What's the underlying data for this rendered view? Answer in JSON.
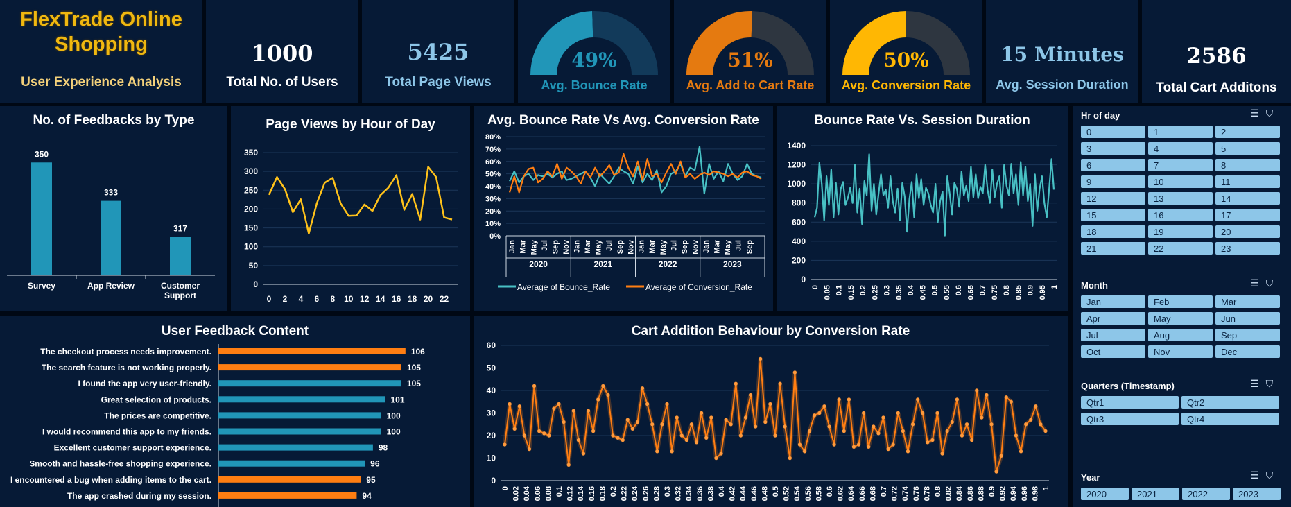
{
  "header": {
    "title": "FlexTrade Online Shopping",
    "subtitle": "User Experience Analysis"
  },
  "kpis": {
    "users": {
      "value": "1000",
      "label": "Total No. of Users"
    },
    "page_views": {
      "value": "5425",
      "label": "Total Page Views"
    },
    "session": {
      "value": "15 Minutes",
      "label": "Avg. Session Duration"
    },
    "cart": {
      "value": "2586",
      "label": "Total Cart Additons"
    }
  },
  "gauges": [
    {
      "value": "49%",
      "label": "Avg. Bounce Rate",
      "fraction": 0.49,
      "color": "#2196b8",
      "track": "#123a5a"
    },
    {
      "value": "51%",
      "label": "Avg. Add to Cart Rate",
      "fraction": 0.51,
      "color": "#e57a10",
      "track": "#2e3640"
    },
    {
      "value": "50%",
      "label": "Avg. Conversion Rate",
      "fraction": 0.5,
      "color": "#ffb703",
      "track": "#2e3640"
    }
  ],
  "colors": {
    "panel": "#061a36",
    "title_gold": "#f0b810",
    "subtitle_gold": "#f3d07a",
    "teal": "#2196b8",
    "orange": "#ff7e12",
    "yellow": "#ffc21a",
    "cyan_line": "#48c0c4",
    "slicer_btn": "#8dc6e8"
  },
  "slicers": {
    "hour": {
      "title": "Hr of day",
      "items": [
        "0",
        "1",
        "2",
        "3",
        "4",
        "5",
        "6",
        "7",
        "8",
        "9",
        "10",
        "11",
        "12",
        "13",
        "14",
        "15",
        "16",
        "17",
        "18",
        "19",
        "20",
        "21",
        "22",
        "23"
      ]
    },
    "month": {
      "title": "Month",
      "items": [
        "Jan",
        "Feb",
        "Mar",
        "Apr",
        "May",
        "Jun",
        "Jul",
        "Aug",
        "Sep",
        "Oct",
        "Nov",
        "Dec"
      ]
    },
    "quarter": {
      "title": "Quarters (Timestamp)",
      "items": [
        "Qtr1",
        "Qtr2",
        "Qtr3",
        "Qtr4"
      ]
    },
    "year": {
      "title": "Year",
      "items": [
        "2020",
        "2021",
        "2022",
        "2023"
      ]
    },
    "icons": [
      "multi-select-icon",
      "clear-filter-icon"
    ]
  },
  "chart_data": [
    {
      "id": "feedbacks",
      "type": "bar",
      "title": "No. of Feedbacks by Type",
      "categories": [
        "Survey",
        "App Review",
        "Customer Support"
      ],
      "values": [
        350,
        333,
        317
      ],
      "ylim": [
        300,
        355
      ],
      "grid": false,
      "color": "#2196b8"
    },
    {
      "id": "pageviews",
      "type": "line",
      "title": "Page Views by Hour of Day",
      "x": [
        0,
        1,
        2,
        3,
        4,
        5,
        6,
        7,
        8,
        9,
        10,
        11,
        12,
        13,
        14,
        15,
        16,
        17,
        18,
        19,
        20,
        21,
        22,
        23
      ],
      "values": [
        238,
        285,
        253,
        192,
        226,
        135,
        215,
        270,
        283,
        215,
        182,
        183,
        212,
        195,
        237,
        257,
        290,
        198,
        240,
        172,
        312,
        285,
        178,
        172
      ],
      "yticks": [
        0,
        50,
        100,
        150,
        200,
        250,
        300,
        350
      ],
      "xticks": [
        0,
        2,
        4,
        6,
        8,
        10,
        12,
        14,
        16,
        18,
        20,
        22
      ],
      "ylim": [
        0,
        350
      ],
      "grid": true,
      "color": "#ffc21a"
    },
    {
      "id": "bounce_conv",
      "type": "line",
      "title": "Avg. Bounce Rate Vs Avg. Conversion Rate",
      "month_labels": [
        "Jan",
        "Mar",
        "May",
        "Jul",
        "Sep",
        "Nov"
      ],
      "years": [
        "2020",
        "2021",
        "2022",
        "2023"
      ],
      "yticks": [
        "0%",
        "10%",
        "20%",
        "30%",
        "40%",
        "50%",
        "60%",
        "70%",
        "80%"
      ],
      "ylim": [
        0,
        80
      ],
      "grid": true,
      "series": [
        {
          "name": "Average of Bounce_Rate",
          "color": "#48c0c4",
          "values": [
            44,
            52,
            43,
            48,
            50,
            45,
            49,
            48,
            50,
            47,
            50,
            52,
            45,
            46,
            48,
            50,
            52,
            47,
            40,
            50,
            46,
            42,
            48,
            55,
            52,
            50,
            42,
            56,
            43,
            50,
            45,
            53,
            35,
            40,
            50,
            52,
            58,
            48,
            55,
            53,
            72,
            34,
            58,
            46,
            52,
            44,
            58,
            50,
            45,
            48,
            58,
            50,
            48,
            47
          ]
        },
        {
          "name": "Average of Conversion_Rate",
          "color": "#ff7e12",
          "values": [
            35,
            48,
            35,
            48,
            54,
            55,
            43,
            46,
            52,
            48,
            58,
            46,
            55,
            52,
            48,
            42,
            52,
            47,
            55,
            48,
            52,
            57,
            49,
            51,
            66,
            55,
            48,
            60,
            45,
            62,
            48,
            50,
            43,
            51,
            58,
            50,
            60,
            47,
            50,
            46,
            49,
            51,
            49,
            52,
            51,
            50,
            48,
            50,
            47,
            51,
            52,
            49,
            48,
            46
          ]
        }
      ]
    },
    {
      "id": "bounce_session",
      "type": "line",
      "title": "Bounce Rate Vs. Session Duration",
      "yticks": [
        0,
        200,
        400,
        600,
        800,
        1000,
        1200,
        1400
      ],
      "xticks": [
        "0",
        "0.05",
        "0.1",
        "0.15",
        "0.2",
        "0.25",
        "0.3",
        "0.35",
        "0.4",
        "0.45",
        "0.5",
        "0.55",
        "0.6",
        "0.65",
        "0.7",
        "0.75",
        "0.8",
        "0.85",
        "0.9",
        "0.95",
        "1"
      ],
      "ylim": [
        0,
        1400
      ],
      "grid": true,
      "color": "#48c0c4",
      "values": [
        650,
        750,
        1220,
        1000,
        620,
        1080,
        780,
        1150,
        650,
        1010,
        680,
        950,
        1020,
        780,
        850,
        960,
        800,
        1200,
        700,
        950,
        580,
        1030,
        880,
        1310,
        720,
        1000,
        680,
        900,
        1100,
        880,
        940,
        750,
        1080,
        820,
        700,
        950,
        620,
        1010,
        870,
        500,
        840,
        1020,
        650,
        1100,
        850,
        1050,
        780,
        960,
        900,
        780,
        700,
        1000,
        600,
        820,
        920,
        460,
        1080,
        900,
        680,
        1010,
        950,
        760,
        1130,
        880,
        980,
        820,
        1180,
        860,
        1100,
        850,
        970,
        900,
        1200,
        940,
        800,
        1150,
        860,
        1000,
        1080,
        750,
        1200,
        980,
        880,
        1210,
        900,
        1100,
        780,
        1230,
        880,
        1180,
        820,
        1000,
        560,
        1100,
        720,
        950,
        1080,
        800,
        650,
        950,
        1260,
        940
      ]
    },
    {
      "id": "feedback_content",
      "type": "bar",
      "title": "User Feedback Content",
      "orientation": "horizontal",
      "categories": [
        "The checkout process needs improvement.",
        "The search feature is not working properly.",
        "I found the app very user-friendly.",
        "Great selection of products.",
        "The prices are competitive.",
        "I would recommend this app to my friends.",
        "Excellent customer support experience.",
        "Smooth and hassle-free shopping experience.",
        "I encountered a bug when adding items to the cart.",
        "The app crashed during my session."
      ],
      "values": [
        106,
        105,
        105,
        101,
        100,
        100,
        98,
        96,
        95,
        94
      ],
      "colors": [
        "#ff7e12",
        "#ff7e12",
        "#2196b8",
        "#2196b8",
        "#2196b8",
        "#2196b8",
        "#2196b8",
        "#2196b8",
        "#ff7e12",
        "#ff7e12"
      ],
      "xlim": [
        0,
        112
      ]
    },
    {
      "id": "cart_conv",
      "type": "line",
      "title": "Cart Addition Behaviour by Conversion Rate",
      "yticks": [
        0,
        10,
        20,
        30,
        40,
        50,
        60
      ],
      "xticks": [
        "0",
        "0.02",
        "0.04",
        "0.06",
        "0.08",
        "0.1",
        "0.12",
        "0.14",
        "0.16",
        "0.18",
        "0.2",
        "0.22",
        "0.24",
        "0.26",
        "0.28",
        "0.3",
        "0.32",
        "0.34",
        "0.36",
        "0.38",
        "0.4",
        "0.42",
        "0.44",
        "0.46",
        "0.48",
        "0.5",
        "0.52",
        "0.54",
        "0.56",
        "0.58",
        "0.6",
        "0.62",
        "0.64",
        "0.66",
        "0.68",
        "0.7",
        "0.72",
        "0.74",
        "0.76",
        "0.78",
        "0.8",
        "0.82",
        "0.84",
        "0.86",
        "0.88",
        "0.9",
        "0.92",
        "0.94",
        "0.96",
        "0.98",
        "1"
      ],
      "ylim": [
        0,
        60
      ],
      "grid": true,
      "color": "#ff7e12",
      "values": [
        16,
        34,
        23,
        33,
        20,
        14,
        42,
        22,
        21,
        20,
        32,
        34,
        26,
        7,
        31,
        18,
        12,
        31,
        22,
        36,
        42,
        38,
        20,
        19,
        18,
        27,
        23,
        26,
        41,
        34,
        25,
        13,
        25,
        34,
        13,
        28,
        20,
        18,
        25,
        17,
        30,
        19,
        28,
        10,
        12,
        27,
        25,
        43,
        20,
        28,
        38,
        24,
        54,
        26,
        34,
        20,
        43,
        24,
        10,
        48,
        16,
        13,
        22,
        29,
        30,
        33,
        24,
        16,
        36,
        22,
        36,
        15,
        16,
        30,
        15,
        24,
        21,
        28,
        14,
        16,
        30,
        22,
        13,
        25,
        36,
        30,
        17,
        18,
        30,
        12,
        22,
        26,
        36,
        20,
        25,
        18,
        40,
        28,
        38,
        25,
        4,
        11,
        37,
        35,
        20,
        13,
        25,
        27,
        33,
        25,
        22
      ]
    }
  ]
}
